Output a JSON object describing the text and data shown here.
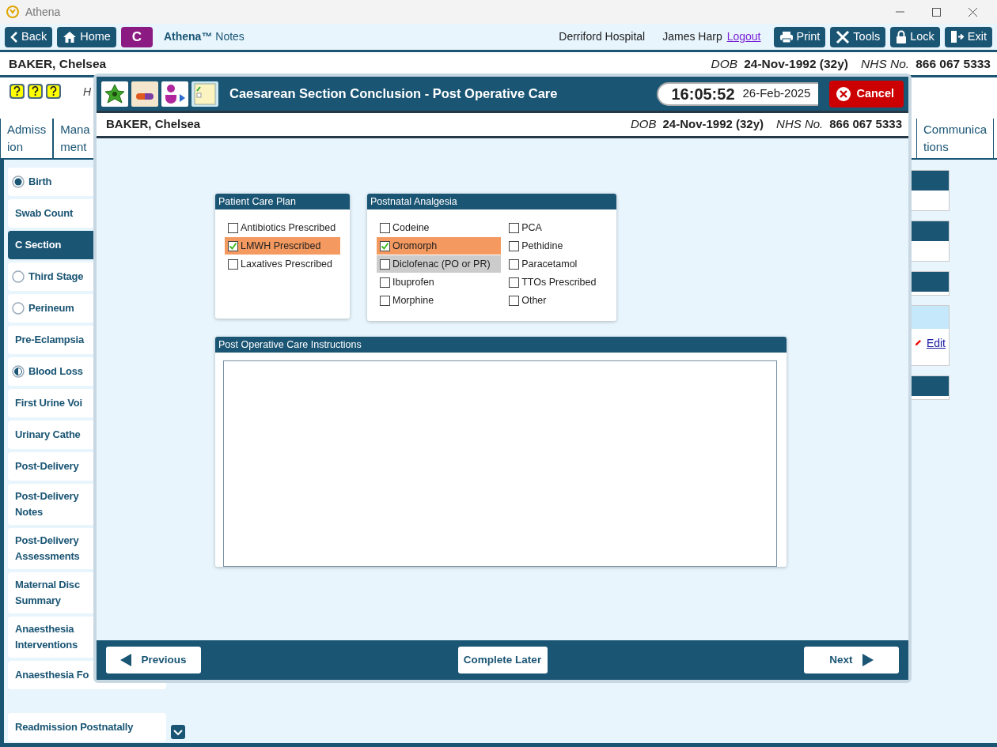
{
  "window": {
    "title": "Athena"
  },
  "toolbar": {
    "buttons_left": [
      {
        "kind": "back",
        "label": "Back"
      },
      {
        "kind": "home",
        "label": "Home"
      },
      {
        "kind": "letter",
        "label": "C"
      }
    ],
    "app_name": "Athena™",
    "app_suffix": "Notes",
    "hospital": "Derriford Hospital",
    "user": "James Harp",
    "logout": "Logout",
    "buttons_right": [
      {
        "kind": "print",
        "label": "Print"
      },
      {
        "kind": "tools",
        "label": "Tools"
      },
      {
        "kind": "lock",
        "label": "Lock"
      },
      {
        "kind": "exit",
        "label": "Exit"
      }
    ]
  },
  "patient": {
    "name": "BAKER, Chelsea",
    "dob_label": "DOB",
    "dob": "24-Nov-1992 (32y)",
    "nhs_label": "NHS No.",
    "nhs": "866 067 5333"
  },
  "help_row": {
    "text": "H"
  },
  "tabs_left": [
    {
      "lines": [
        "Admiss",
        "ion"
      ]
    },
    {
      "lines": [
        "Mana",
        "ment"
      ]
    }
  ],
  "tabs_right": [
    {
      "lines": [
        "Communica",
        "tions"
      ]
    }
  ],
  "sidebar": {
    "items": [
      {
        "lines": [
          "Birth"
        ],
        "kind": "complete",
        "selected": false
      },
      {
        "lines": [
          "Swab Count"
        ],
        "kind": "plain",
        "selected": false
      },
      {
        "lines": [
          "C Section"
        ],
        "kind": "plain",
        "selected": true
      },
      {
        "lines": [
          "Third Stage"
        ],
        "kind": "pending",
        "selected": false
      },
      {
        "lines": [
          "Perineum"
        ],
        "kind": "pending",
        "selected": false
      },
      {
        "lines": [
          "Pre-Eclampsia"
        ],
        "kind": "plain",
        "selected": false
      },
      {
        "lines": [
          "Blood Loss"
        ],
        "kind": "partial",
        "selected": false
      },
      {
        "lines": [
          "First Urine Voi"
        ],
        "kind": "plain",
        "selected": false
      },
      {
        "lines": [
          "Urinary Cathe"
        ],
        "kind": "plain",
        "selected": false
      },
      {
        "lines": [
          "Post-Delivery"
        ],
        "kind": "plain",
        "selected": false
      },
      {
        "lines": [
          "Post-Delivery",
          "Notes"
        ],
        "kind": "plain",
        "selected": false
      },
      {
        "lines": [
          "Post-Delivery",
          "Assessments"
        ],
        "kind": "plain",
        "selected": false
      },
      {
        "lines": [
          "Maternal Disc",
          "Summary"
        ],
        "kind": "plain",
        "selected": false
      },
      {
        "lines": [
          "Anaesthesia",
          "Interventions"
        ],
        "kind": "plain",
        "selected": false
      },
      {
        "lines": [
          "Anaesthesia Fo"
        ],
        "kind": "plain",
        "selected": false
      },
      {
        "lines": [
          "Readmission Postnatally"
        ],
        "kind": "detached",
        "selected": false
      }
    ]
  },
  "right_panels": [
    {
      "kind": "titled"
    },
    {
      "kind": "titled"
    },
    {
      "kind": "bar"
    },
    {
      "kind": "edit",
      "link": "Edit"
    },
    {
      "kind": "bar"
    }
  ],
  "modal": {
    "title": "Caesarean Section Conclusion - Post Operative Care",
    "time": "16:05:52",
    "date": "26-Feb-2025",
    "cancel": "Cancel",
    "patient": {
      "name": "BAKER, Chelsea",
      "dob_label": "DOB",
      "dob": "24-Nov-1992 (32y)",
      "nhs_label": "NHS No.",
      "nhs": "866 067 5333"
    },
    "groups": [
      {
        "title": "Patient Care Plan",
        "items": [
          {
            "label": "Antibiotics Prescribed",
            "checked": false,
            "focused": false
          },
          {
            "label": "LMWH Prescribed",
            "checked": true,
            "focused": false
          },
          {
            "label": "Laxatives Prescribed",
            "checked": false,
            "focused": false
          }
        ]
      },
      {
        "title": "Postnatal Analgesia",
        "items": [
          {
            "label": "Codeine",
            "checked": false,
            "focused": false
          },
          {
            "label": "Oromorph",
            "checked": true,
            "focused": false
          },
          {
            "label": "Diclofenac (PO or PR)",
            "checked": false,
            "focused": true
          },
          {
            "label": "Ibuprofen",
            "checked": false,
            "focused": false
          },
          {
            "label": "Morphine",
            "checked": false,
            "focused": false
          },
          {
            "label": "PCA",
            "checked": false,
            "focused": false
          },
          {
            "label": "Pethidine",
            "checked": false,
            "focused": false
          },
          {
            "label": "Paracetamol",
            "checked": false,
            "focused": false
          },
          {
            "label": "TTOs Prescribed",
            "checked": false,
            "focused": false
          },
          {
            "label": "Other",
            "checked": false,
            "focused": false
          }
        ]
      }
    ],
    "instructions": {
      "title": "Post Operative Care Instructions"
    },
    "footer": {
      "previous": "Previous",
      "complete_later": "Complete Later",
      "next": "Next"
    }
  }
}
